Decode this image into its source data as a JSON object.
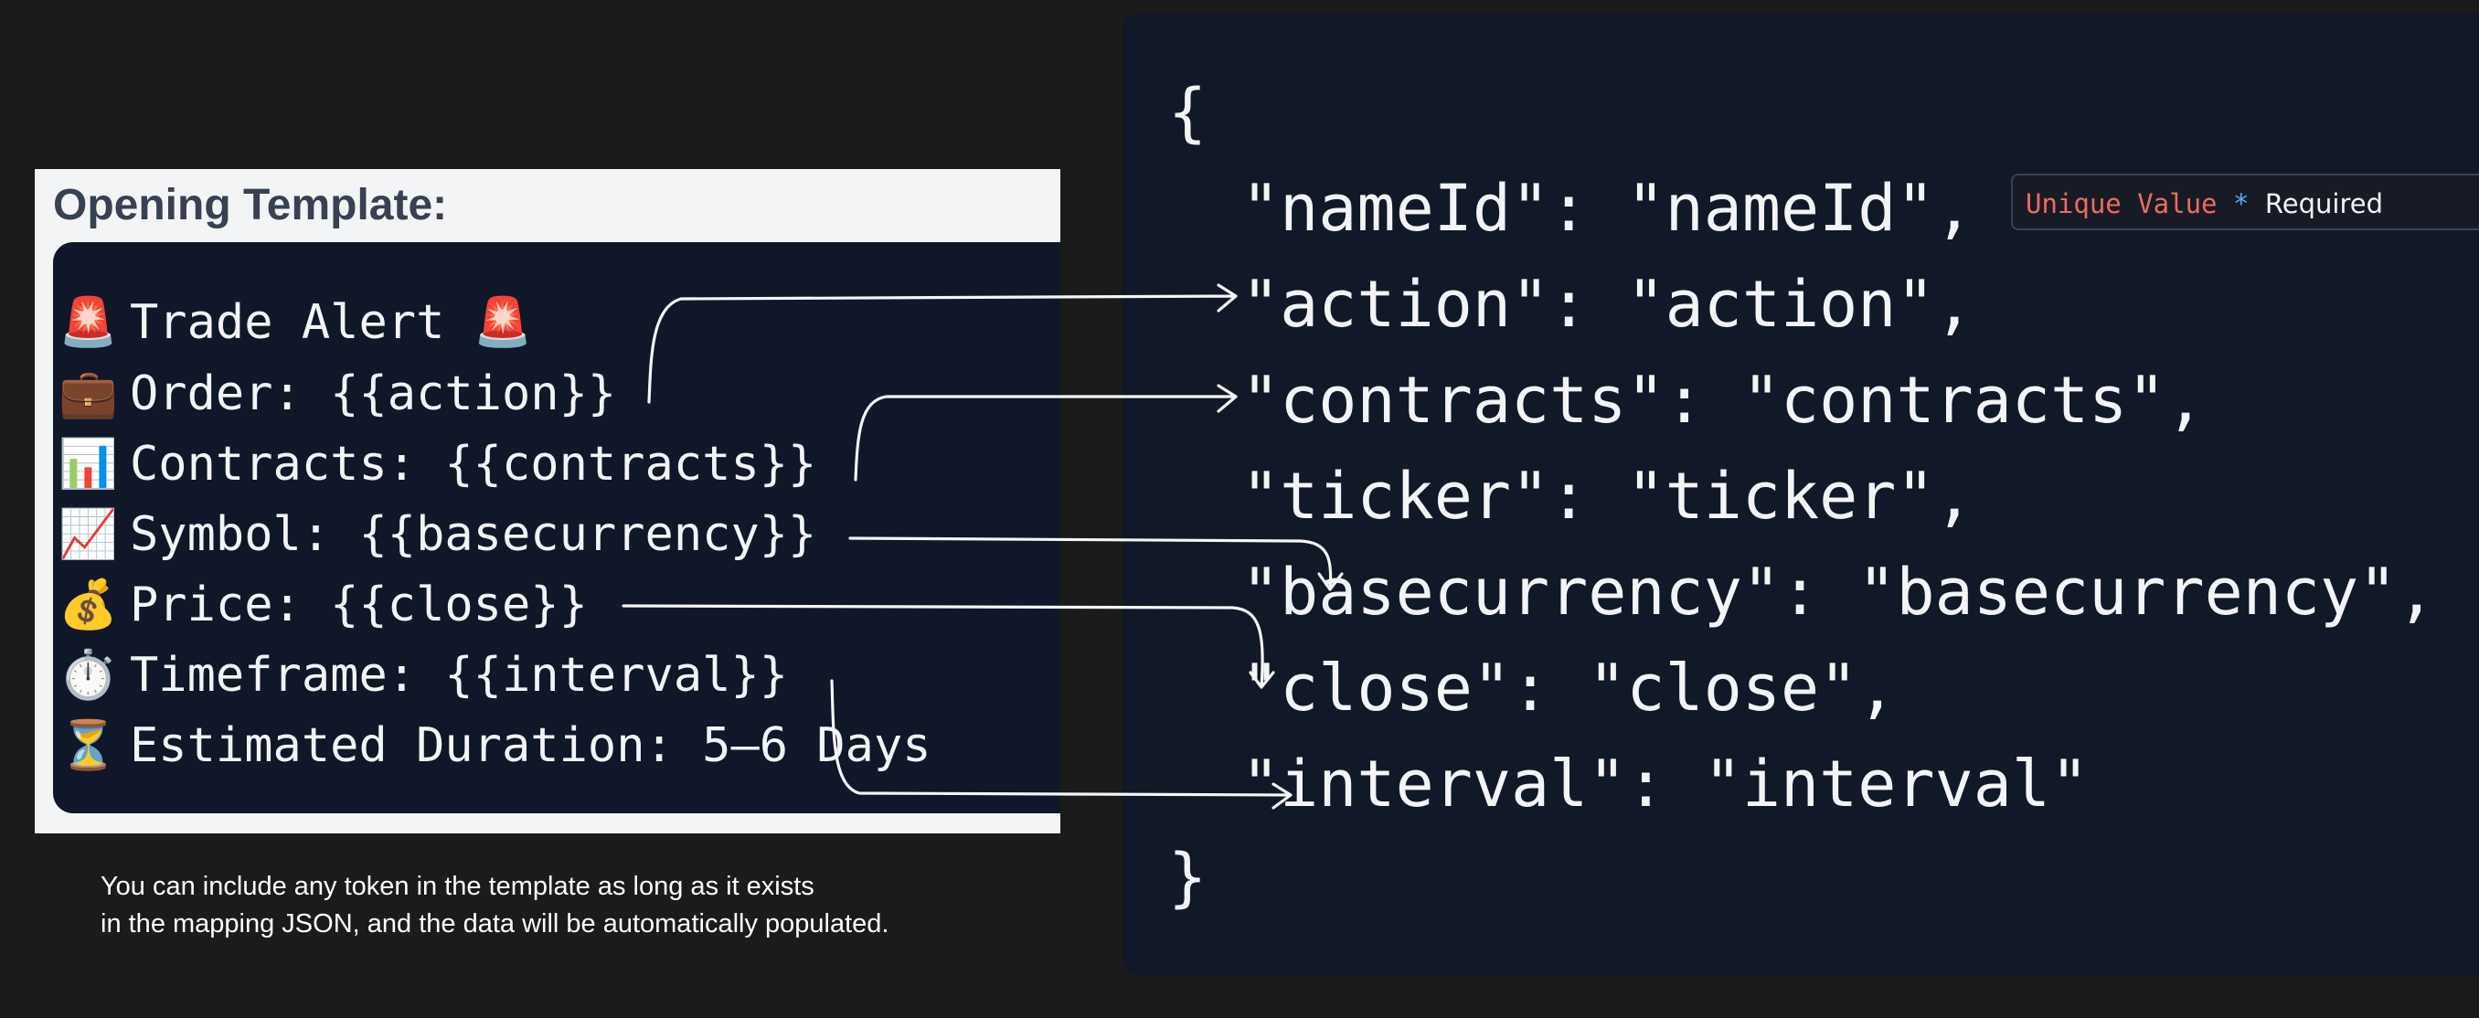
{
  "left": {
    "title": "Opening Template:",
    "lines": [
      {
        "emoji_before": "🚨",
        "text": "Trade Alert",
        "emoji_after": "🚨"
      },
      {
        "emoji_before": "💼",
        "text": "Order: {{action}}"
      },
      {
        "emoji_before": "📊",
        "text": "Contracts: {{contracts}}"
      },
      {
        "emoji_before": "📈",
        "text": "Symbol: {{basecurrency}}"
      },
      {
        "emoji_before": "💰",
        "text": "Price: {{close}}"
      },
      {
        "emoji_before": "⏱️",
        "text": "Timeframe: {{interval}}"
      },
      {
        "emoji_before": "⏳",
        "text": "Estimated Duration: 5–6 Days"
      }
    ]
  },
  "caption": {
    "line1": "You can include any token in the template as long as it exists",
    "line2": "in the mapping JSON, and the data will be automatically populated."
  },
  "json": {
    "open_brace": "{",
    "lines": [
      "\"nameId\": \"nameId\",",
      "\"action\": \"action\",",
      "\"contracts\": \"contracts\",",
      "\"ticker\": \"ticker\",",
      "\"basecurrency\": \"basecurrency\",",
      "\"close\": \"close\",",
      "\"interval\": \"interval\""
    ],
    "close_brace": "}"
  },
  "badge": {
    "unique": "Unique Value",
    "star": "*",
    "required": "Required"
  },
  "colors": {
    "background": "#1b1b1b",
    "panel_dark": "#111827",
    "template_box": "#0f1729",
    "badge_unique": "#ef6b5b",
    "badge_star": "#60a5fa"
  }
}
